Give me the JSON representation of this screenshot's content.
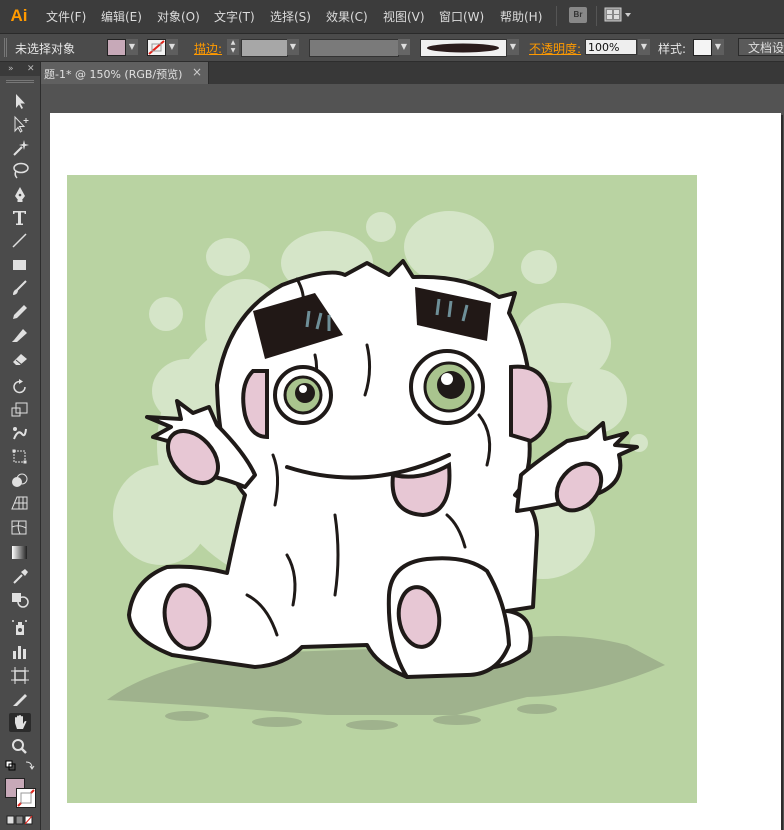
{
  "app": {
    "logo": "Ai"
  },
  "menu": {
    "items": [
      "文件(F)",
      "编辑(E)",
      "对象(O)",
      "文字(T)",
      "选择(S)",
      "效果(C)",
      "视图(V)",
      "窗口(W)",
      "帮助(H)"
    ],
    "bridge_label": "Br"
  },
  "control_bar": {
    "selection_label": "未选择对象",
    "stroke_label": "描边:",
    "opacity_label": "不透明度:",
    "opacity_value": "100%",
    "style_label": "样式:",
    "doc_setup_label": "文档设",
    "fill_color": "#c7a9b8",
    "accent_color": "#ff9a00"
  },
  "panel": {
    "collapse_label": "»",
    "close_label": "✕"
  },
  "document_tab": {
    "title": "题-1* @ 150% (RGB/预览)",
    "close_label": "×"
  },
  "toolbar": {
    "tools": [
      "selection-tool-icon",
      "direct-selection-tool-icon",
      "magic-wand-tool-icon",
      "lasso-tool-icon",
      "pen-tool-icon",
      "type-tool-icon",
      "line-segment-tool-icon",
      "rectangle-tool-icon",
      "paintbrush-tool-icon",
      "pencil-tool-icon",
      "blob-brush-tool-icon",
      "eraser-tool-icon",
      "rotate-tool-icon",
      "scale-tool-icon",
      "warp-tool-icon",
      "free-transform-tool-icon",
      "shape-builder-tool-icon",
      "perspective-grid-tool-icon",
      "mesh-tool-icon",
      "gradient-tool-icon",
      "eyedropper-tool-icon",
      "blend-tool-icon",
      "symbol-sprayer-tool-icon",
      "column-graph-tool-icon",
      "artboard-tool-icon",
      "slice-tool-icon",
      "hand-tool-icon",
      "zoom-tool-icon"
    ],
    "active_tool": "hand-tool-icon"
  },
  "artwork": {
    "background_color": "#b9d3a2",
    "subject": "monster-illustration"
  }
}
